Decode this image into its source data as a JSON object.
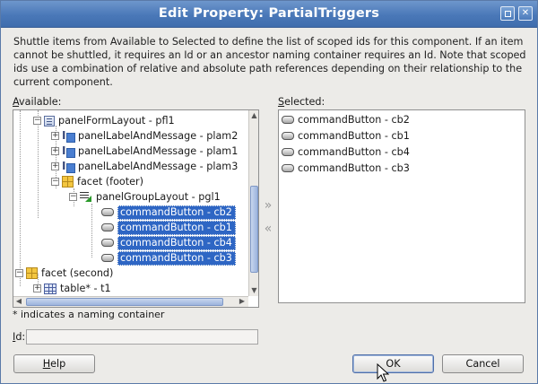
{
  "window": {
    "title": "Edit Property: PartialTriggers"
  },
  "description": "Shuttle items from Available to Selected to define the list of scoped ids for this component. If an item cannot be shuttled, it requires an Id or an ancestor naming container requires an Id. Note that scoped ids use a combination of relative and absolute path references depending on their relationship to the current component.",
  "available": {
    "label_prefix": "",
    "label_mnemonic": "A",
    "label_rest": "vailable:",
    "items": [
      {
        "label": "panelFormLayout - pfl1",
        "icon": "form-layout-icon",
        "expander": "−"
      },
      {
        "label": "panelLabelAndMessage - plam2",
        "icon": "label-message-icon",
        "expander": "+"
      },
      {
        "label": "panelLabelAndMessage - plam1",
        "icon": "label-message-icon",
        "expander": "+"
      },
      {
        "label": "panelLabelAndMessage - plam3",
        "icon": "label-message-icon",
        "expander": "+"
      },
      {
        "label": "facet (footer)",
        "icon": "facet-icon",
        "expander": "−"
      },
      {
        "label": "panelGroupLayout - pgl1",
        "icon": "group-layout-icon",
        "expander": "−"
      },
      {
        "label": "commandButton - cb2",
        "icon": "button-icon",
        "selected": true
      },
      {
        "label": "commandButton - cb1",
        "icon": "button-icon",
        "selected": true
      },
      {
        "label": "commandButton - cb4",
        "icon": "button-icon",
        "selected": true
      },
      {
        "label": "commandButton - cb3",
        "icon": "button-icon",
        "selected": true
      },
      {
        "label": "facet (second)",
        "icon": "facet-icon",
        "expander": "−"
      },
      {
        "label": "table* - t1",
        "icon": "table-icon",
        "expander": "+"
      }
    ]
  },
  "shuttle": {
    "move_right": "»",
    "move_left": "«"
  },
  "selected": {
    "label_mnemonic": "S",
    "label_rest": "elected:",
    "items": [
      {
        "label": "commandButton - cb2",
        "icon": "button-icon"
      },
      {
        "label": "commandButton - cb1",
        "icon": "button-icon"
      },
      {
        "label": "commandButton - cb4",
        "icon": "button-icon"
      },
      {
        "label": "commandButton - cb3",
        "icon": "button-icon"
      }
    ]
  },
  "note": "* indicates a naming container",
  "id_field": {
    "label_mnemonic": "I",
    "label_rest": "d:",
    "value": ""
  },
  "buttons": {
    "help": "Help",
    "help_mnemonic": "H",
    "help_rest": "elp",
    "ok": "OK",
    "cancel": "Cancel"
  }
}
